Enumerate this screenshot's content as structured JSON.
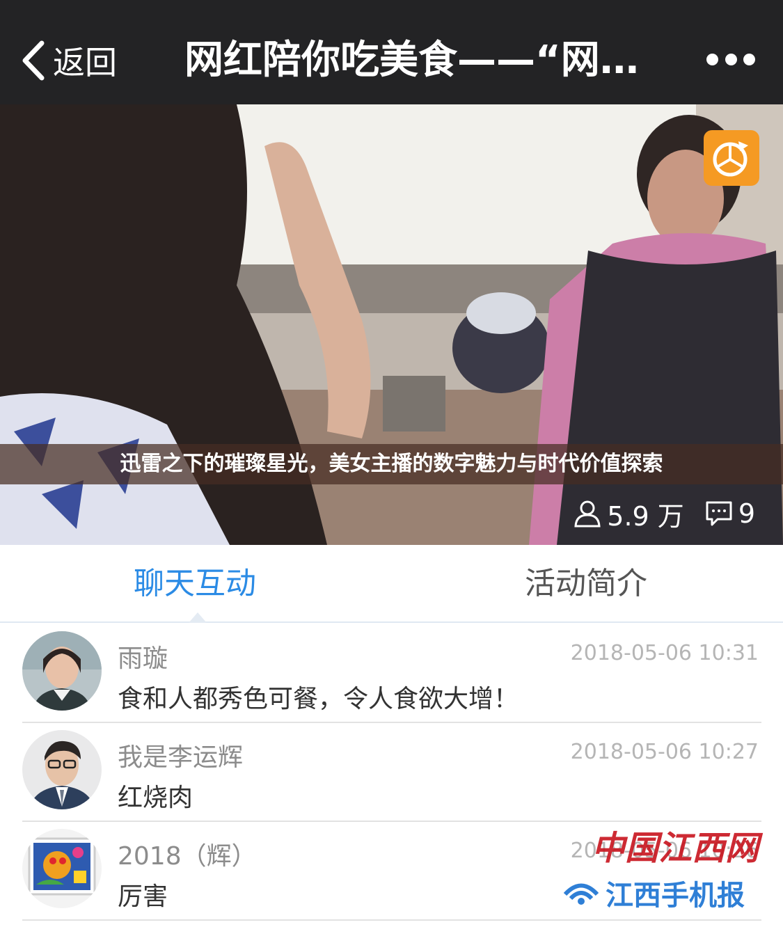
{
  "header": {
    "back_label": "返回",
    "title": "网红陪你吃美食——“网…"
  },
  "video": {
    "caption": "迅雷之下的璀璨星光，美女主播的数字魅力与时代价值探索",
    "viewers": "5.9 万",
    "comments_count": "9"
  },
  "tabs": [
    {
      "label": "聊天互动",
      "active": true
    },
    {
      "label": "活动简介",
      "active": false
    }
  ],
  "comments": [
    {
      "name": "雨璇",
      "time": "2018-05-06 10:31",
      "message": "食和人都秀色可餐，令人食欲大增！"
    },
    {
      "name": "我是李运辉",
      "time": "2018-05-06 10:27",
      "message": "红烧肉"
    },
    {
      "name": "2018（辉）",
      "time": "2018-05-06 10:26",
      "message": "厉害"
    }
  ],
  "watermark": {
    "line1": "中国江西网",
    "line2": "江西手机报"
  },
  "colors": {
    "topbar": "#232325",
    "accent": "#2b8be5",
    "badge": "#f59a23"
  }
}
